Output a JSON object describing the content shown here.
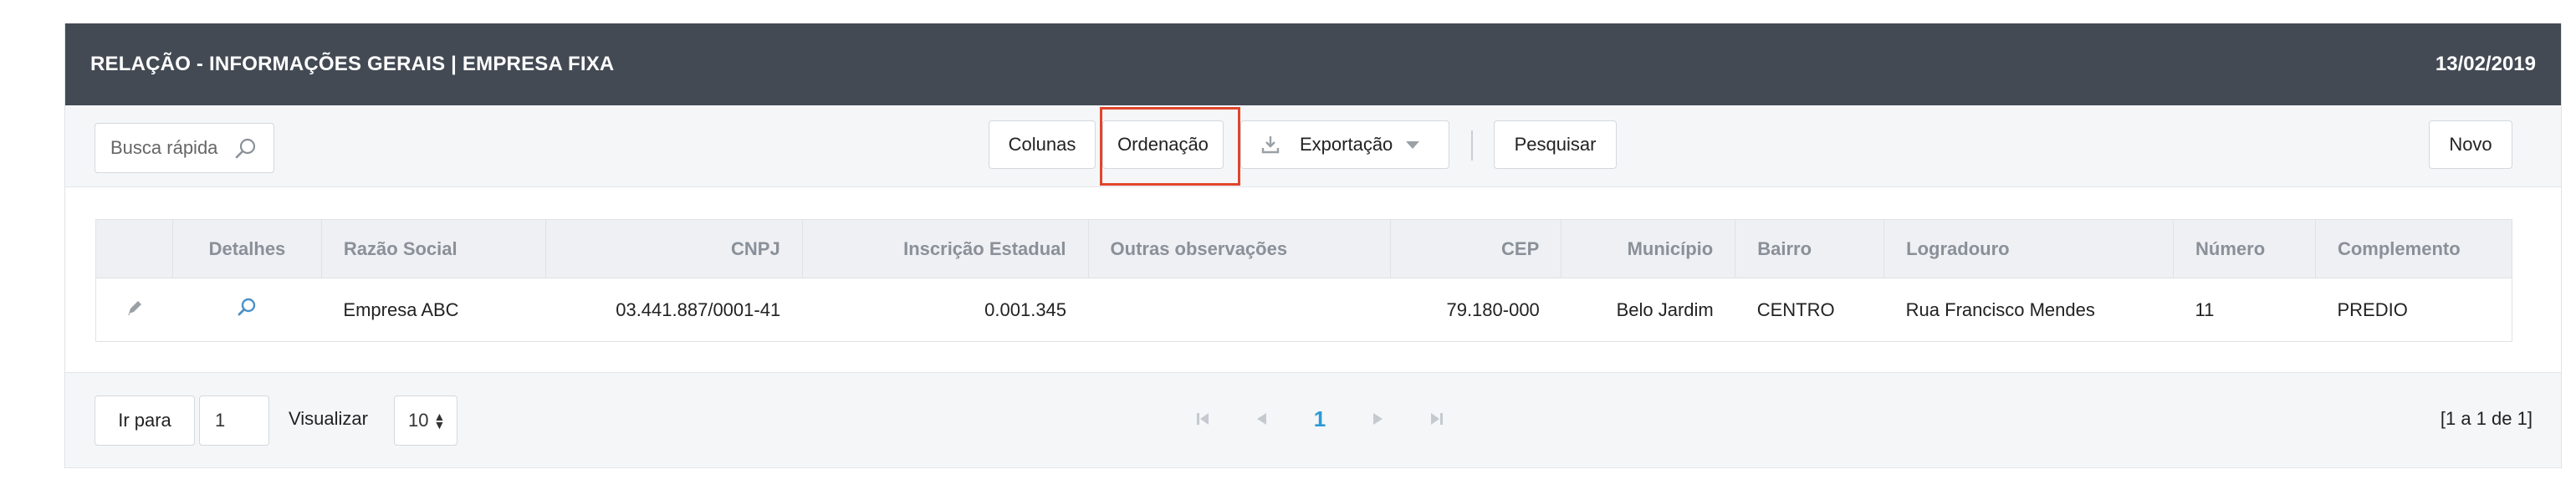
{
  "header": {
    "title": "RELAÇÃO - INFORMAÇÕES GERAIS | EMPRESA FIXA",
    "date": "13/02/2019"
  },
  "toolbar": {
    "search_placeholder": "Busca rápida",
    "colunas_label": "Colunas",
    "ordenacao_label": "Ordenação",
    "exportacao_label": "Exportação",
    "pesquisar_label": "Pesquisar",
    "novo_label": "Novo"
  },
  "table": {
    "headers": [
      "",
      "Detalhes",
      "Razão Social",
      "CNPJ",
      "Inscrição Estadual",
      "Outras observações",
      "CEP",
      "Município",
      "Bairro",
      "Logradouro",
      "Número",
      "Complemento"
    ],
    "rows": [
      {
        "razao_social": "Empresa ABC",
        "cnpj": "03.441.887/0001-41",
        "inscricao_estadual": "0.001.345",
        "outras_observacoes": "",
        "cep": "79.180-000",
        "municipio": "Belo Jardim",
        "bairro": "CENTRO",
        "logradouro": "Rua Francisco Mendes",
        "numero": "11",
        "complemento": "PREDIO"
      }
    ]
  },
  "footer": {
    "ir_para_label": "Ir para",
    "page_input_value": "1",
    "visualizar_label": "Visualizar",
    "page_size_value": "10",
    "current_page": "1",
    "range_text": "[1 a 1 de 1]"
  },
  "colors": {
    "header_bg": "#434a54",
    "highlight": "#e0452c",
    "active_page": "#2b9ad6"
  }
}
